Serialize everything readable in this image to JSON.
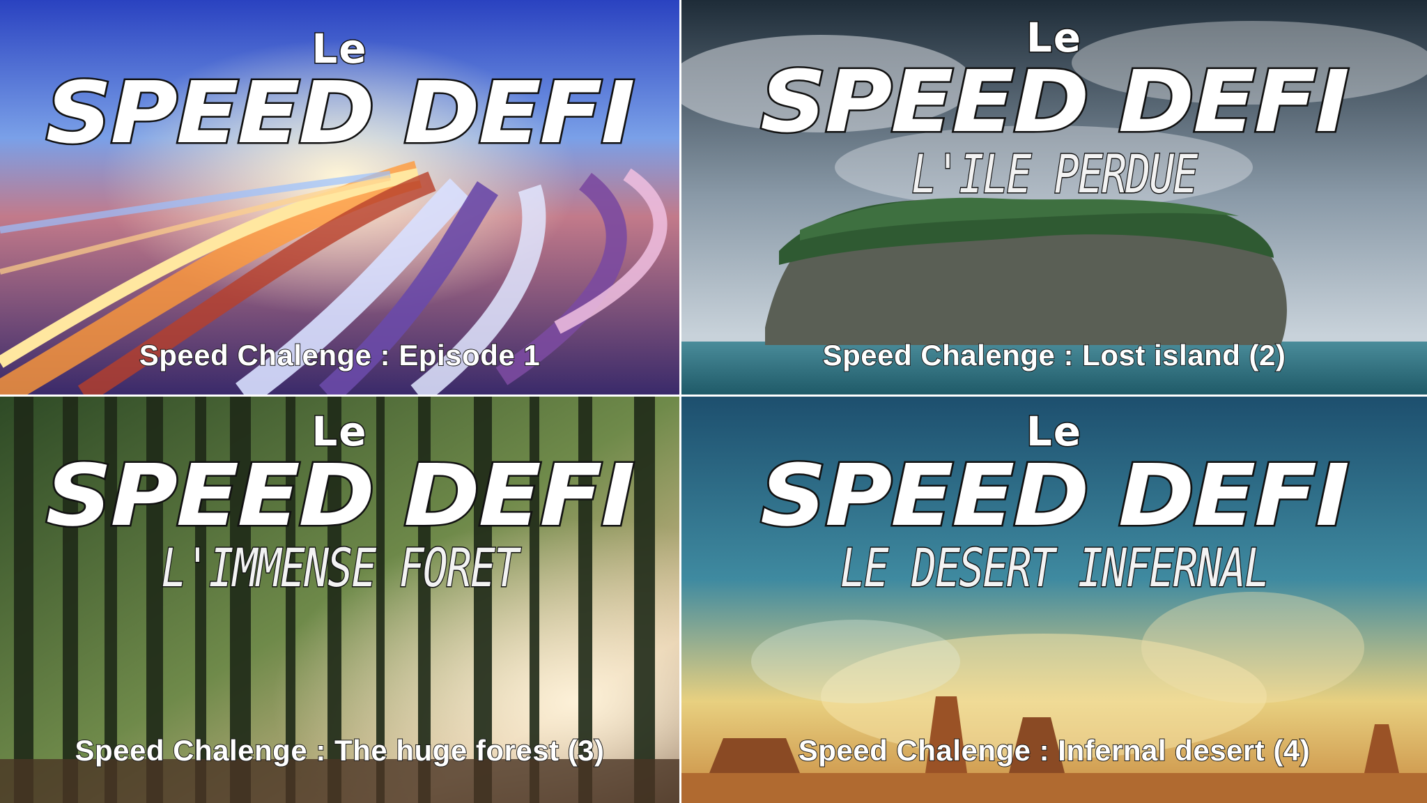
{
  "tiles": [
    {
      "le": "Le",
      "title": "SPEED DEFI",
      "subtitle": "",
      "caption": "Speed Chalenge : Episode 1"
    },
    {
      "le": "Le",
      "title": "SPEED DEFI",
      "subtitle": "L'ILE PERDUE",
      "caption": "Speed Chalenge : Lost island (2)"
    },
    {
      "le": "Le",
      "title": "SPEED DEFI",
      "subtitle": "L'IMMENSE FORET",
      "caption": "Speed Chalenge : The huge forest (3)"
    },
    {
      "le": "Le",
      "title": "SPEED DEFI",
      "subtitle": "LE DESERT INFERNAL",
      "caption": "Speed Chalenge : Infernal desert (4)"
    }
  ],
  "colors": {
    "tile1": "#4a62c8",
    "tile2": "#3f5a6a",
    "tile3": "#3b5a2c",
    "tile4": "#2f6c8a"
  }
}
